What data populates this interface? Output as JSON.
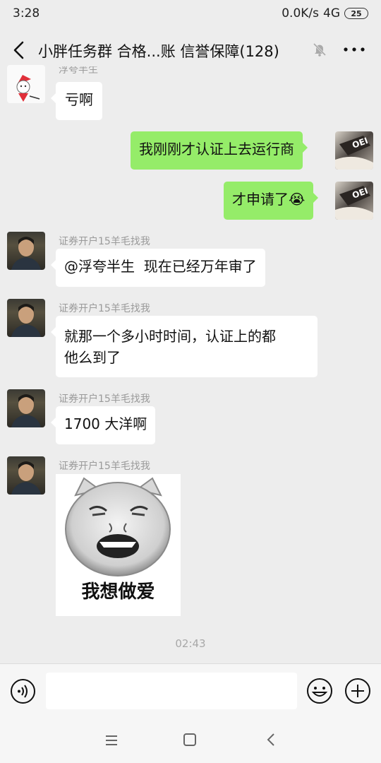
{
  "status_bar": {
    "time": "3:28",
    "network_speed": "0.0K/s",
    "signal": "4G",
    "battery": "25"
  },
  "header": {
    "title": "小胖任务群 合格...账 信誉保障(128)",
    "back_icon": "chevron-left-icon",
    "mute_icon": "bell-off-icon",
    "more_icon": "more-dots-icon"
  },
  "messages": [
    {
      "side": "left",
      "sender": "浮夸半生",
      "text": "亏啊"
    },
    {
      "side": "right",
      "text": "我刚刚才认证上去运行商"
    },
    {
      "side": "right",
      "text": "才申请了😭"
    },
    {
      "side": "left",
      "sender": "证券开户15羊毛找我",
      "text": "@浮夸半生  现在已经万年审了"
    },
    {
      "side": "left",
      "sender": "证券开户15羊毛找我",
      "line1": "就那一个多小时时间，认证上的都",
      "line2": "他么到了"
    },
    {
      "side": "left",
      "sender": "证券开户15羊毛找我",
      "text": "1700 大洋啊"
    },
    {
      "side": "left",
      "sender": "证券开户15羊毛找我",
      "sticker_text": "我想做爱"
    }
  ],
  "timestamp": "02:43",
  "input": {
    "value": "",
    "placeholder": ""
  },
  "colors": {
    "background": "#ededed",
    "self_bubble": "#95ec69",
    "other_bubble": "#ffffff"
  }
}
